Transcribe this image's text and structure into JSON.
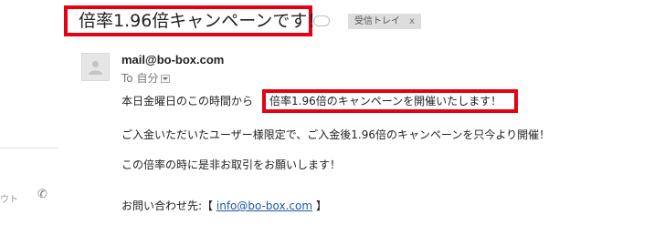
{
  "subject": "倍率1.96倍キャンペーンです！",
  "label": {
    "text": "受信トレイ",
    "close": "x"
  },
  "left_pane": {
    "fragment": "ウト"
  },
  "message": {
    "sender": "mail@bo-box.com",
    "recipient_prefix": "To",
    "recipient": "自分",
    "body": {
      "line1_prefix": "本日金曜日のこの時間から",
      "line1_highlight": "倍率1.96倍のキャンペーンを開催いたします！",
      "line2": "ご入金いただいたユーザー様限定で、ご入金後1.96倍のキャンペーンを只今より開催！",
      "line3": "この倍率の時に是非お取引をお願いします！",
      "contact_label": "お問い合わせ先:【",
      "contact_email": "info@bo-box.com",
      "contact_close": "】"
    }
  },
  "colors": {
    "highlight_border": "#e60012",
    "link": "#1a5aa8",
    "chip_bg": "#dddddd"
  },
  "icons": {
    "avatar": "person-icon",
    "phone": "phone-icon",
    "dropdown": "chevron-down-icon"
  }
}
